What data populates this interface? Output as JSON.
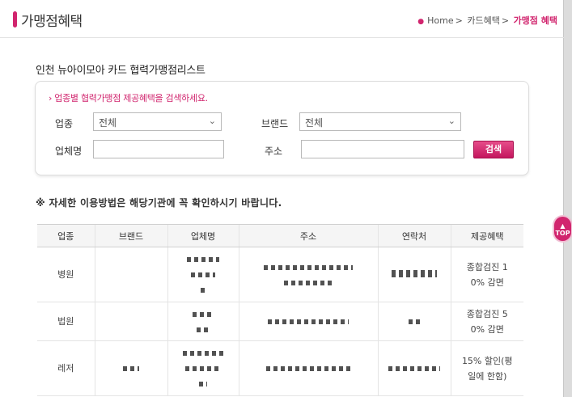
{
  "header": {
    "title": "가맹점혜택",
    "breadcrumb": {
      "home": "Home",
      "sep": ">",
      "level1": "카드혜택",
      "current": "가맹점 혜택"
    }
  },
  "section_title": "인천 뉴아이모아 카드 협력가맹점리스트",
  "search": {
    "notice": "› 업종별 협력가맹점 제공혜택을 검색하세요.",
    "category_label": "업종",
    "category_value": "전체",
    "brand_label": "브랜드",
    "brand_value": "전체",
    "name_label": "업체명",
    "name_value": "",
    "address_label": "주소",
    "address_value": "",
    "button_label": "검색"
  },
  "note": "※ 자세한 이용방법은 해당기관에 꼭 확인하시기 바랍니다.",
  "table": {
    "headers": [
      "업종",
      "브랜드",
      "업체명",
      "주소",
      "연락처",
      "제공혜택"
    ],
    "rows": [
      {
        "category": "병원",
        "benefit_line1": "종합검진 1",
        "benefit_line2": "0% 감면"
      },
      {
        "category": "법원",
        "benefit_line1": "종합검진 5",
        "benefit_line2": "0% 감면"
      },
      {
        "category": "레저",
        "benefit_line1": "15% 할인(평",
        "benefit_line2": "일에 한함)"
      }
    ]
  },
  "top_button": "TOP",
  "colors": {
    "accent": "#d1256e",
    "header_bg": "#f5f5f5"
  }
}
